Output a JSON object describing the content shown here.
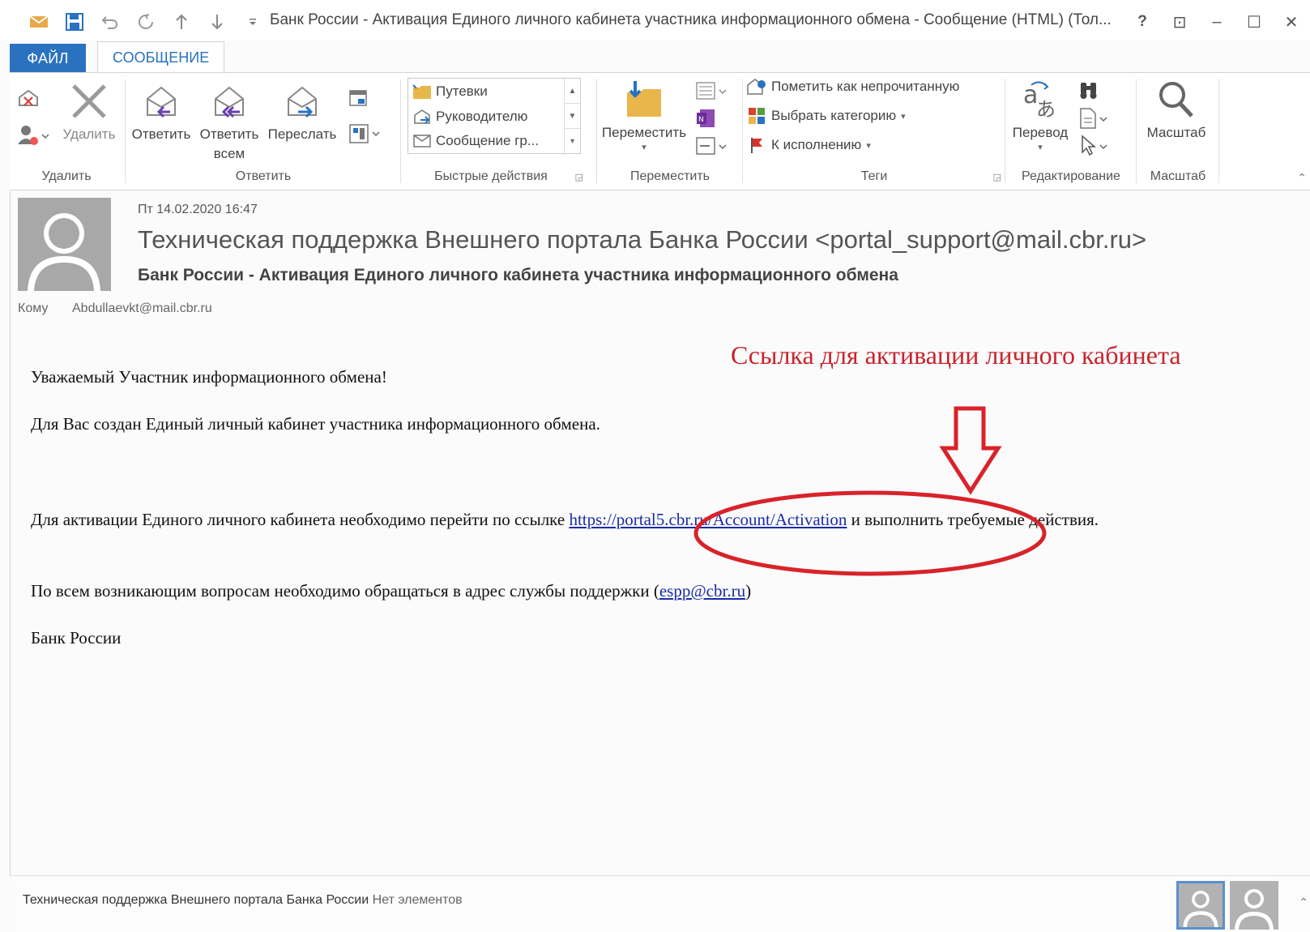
{
  "window": {
    "title": "Банк России - Активация Единого личного кабинета участника информационного обмена - Сообщение (HTML) (Тол...",
    "help": "?",
    "restore_ribbon": "⊡",
    "minimize": "–",
    "maximize": "☐",
    "close": "✕"
  },
  "tabs": {
    "file": "ФАЙЛ",
    "message": "СООБЩЕНИЕ"
  },
  "ribbon": {
    "delete_group": {
      "label": "Удалить",
      "delete": "Удалить"
    },
    "respond_group": {
      "label": "Ответить",
      "reply": "Ответить",
      "reply_all_1": "Ответить",
      "reply_all_2": "всем",
      "forward": "Переслать"
    },
    "quick_group": {
      "label": "Быстрые действия",
      "items": [
        "Путевки",
        "Руководителю",
        "Сообщение гр..."
      ]
    },
    "move_group": {
      "label": "Переместить",
      "move": "Переместить"
    },
    "tags_group": {
      "label": "Теги",
      "mark_unread": "Пометить как непрочитанную",
      "categorize": "Выбрать категорию",
      "follow_up": "К исполнению"
    },
    "edit_group": {
      "label": "Редактирование",
      "translate": "Перевод"
    },
    "zoom_group": {
      "label": "Масштаб",
      "zoom": "Масштаб"
    }
  },
  "message": {
    "date": "Пт 14.02.2020 16:47",
    "sender": "Техническая поддержка Внешнего портала Банка России <portal_support@mail.cbr.ru>",
    "subject": "Банк России - Активация Единого личного кабинета участника информационного обмена",
    "to_label": "Кому",
    "to_value": "Abdullaevkt@mail.cbr.ru",
    "body": {
      "greeting": "Уважаемый Участник информационного обмена!",
      "created": "Для Вас создан Единый личный кабинет участника информационного обмена.",
      "activation_before": "Для активации Единого личного кабинета необходимо перейти по ссылке ",
      "activation_link": "https://portal5.cbr.ru/Account/Activation",
      "activation_after": " и выполнить требуемые действия.",
      "support_before": "По всем возникающим вопросам необходимо обращаться в адрес службы поддержки (",
      "support_email": "espp@cbr.ru",
      "support_after": ")",
      "signature": "Банк России"
    }
  },
  "annotation": {
    "text": "Ссылка для активации личного кабинета",
    "color": "#c8232c"
  },
  "footer": {
    "sender_name": "Техническая поддержка Внешнего портала Банка России",
    "status": "Нет элементов"
  }
}
